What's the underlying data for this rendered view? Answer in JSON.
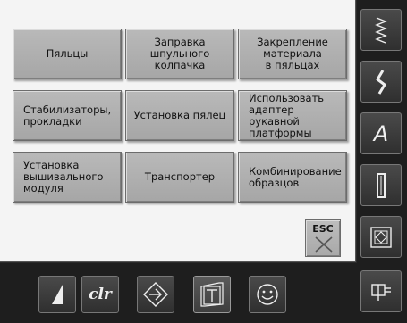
{
  "tiles": [
    {
      "label": "Пяльцы"
    },
    {
      "label": "Заправка\nшпульного\nколпачка"
    },
    {
      "label": "Закрепление\nматериала\nв пяльцах"
    },
    {
      "label": "Стабилизаторы,\nпрокладки"
    },
    {
      "label": "Установка пялец"
    },
    {
      "label": "Использовать\nадаптер рукавной\nплатформы"
    },
    {
      "label": "Установка\nвышивального\nмодуля"
    },
    {
      "label": "Транспортер"
    },
    {
      "label": "Комбинирование\nобразцов"
    }
  ],
  "esc": {
    "label": "ESC"
  },
  "right_toolbar": {
    "buttons": [
      {
        "icon": "zigzag-stitch-icon"
      },
      {
        "icon": "serpentine-stitch-icon"
      },
      {
        "icon": "alphabet-icon",
        "label": "A"
      },
      {
        "icon": "buttonhole-icon"
      },
      {
        "icon": "quilt-icon"
      },
      {
        "icon": "presser-foot-icon"
      }
    ]
  },
  "bottom_toolbar": {
    "buttons": [
      {
        "icon": "stitch-width-icon"
      },
      {
        "icon": "clear-icon",
        "label": "clr"
      },
      {
        "icon": "navigation-icon"
      },
      {
        "icon": "tutorial-icon"
      },
      {
        "icon": "smiley-icon"
      }
    ]
  },
  "colors": {
    "screen_bg": "#f4f4f4",
    "tile": "#b0b0b0",
    "toolbar_bg": "#1e1e1e"
  }
}
